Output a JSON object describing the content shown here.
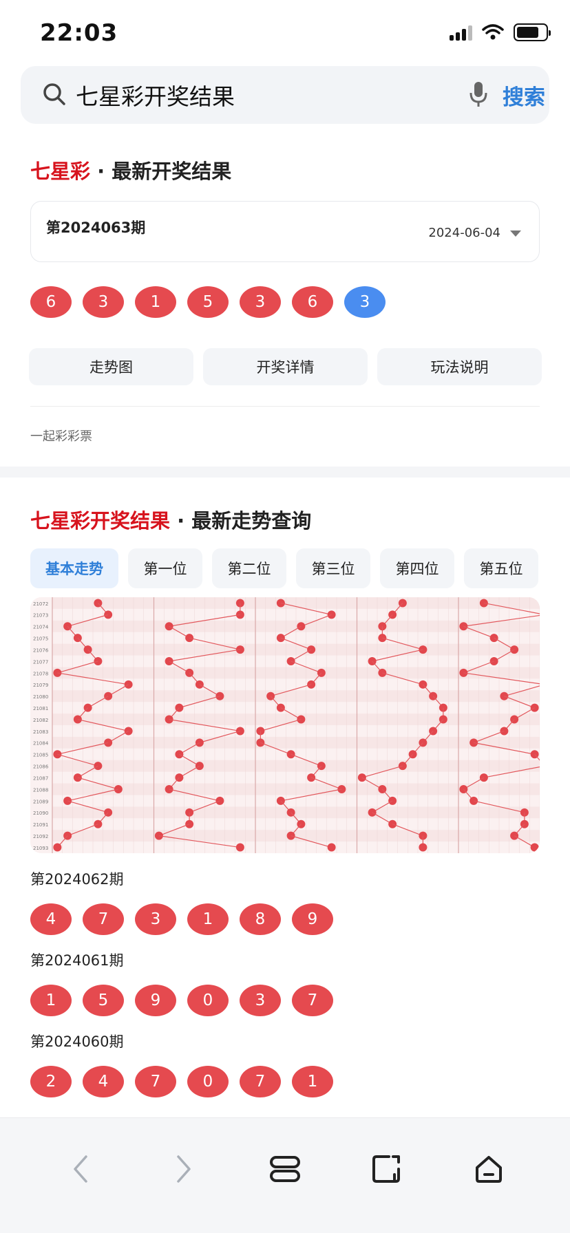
{
  "status_bar": {
    "time": "22:03"
  },
  "search": {
    "query": "七星彩开奖结果",
    "button_label": "搜索"
  },
  "latest": {
    "title_red": "七星彩",
    "title_rest": " · 最新开奖结果",
    "issue": "第2024063期",
    "date": "2024-06-04",
    "numbers": [
      "6",
      "3",
      "1",
      "5",
      "3",
      "6"
    ],
    "special": "3",
    "actions": [
      "走势图",
      "开奖详情",
      "玩法说明"
    ],
    "source": "一起彩彩票"
  },
  "trend": {
    "title_red": "七星彩开奖结果",
    "title_rest": " · 最新走势查询",
    "tabs": [
      "基本走势",
      "第一位",
      "第二位",
      "第三位",
      "第四位",
      "第五位"
    ],
    "active_tab": 0,
    "row_labels": [
      "21072",
      "21073",
      "21074",
      "21075",
      "21076",
      "21077",
      "21078",
      "21079",
      "21080",
      "21081",
      "21082",
      "21083",
      "21084",
      "21085",
      "21086",
      "21087",
      "21088",
      "21089",
      "21090",
      "21091",
      "21092",
      "21093"
    ]
  },
  "history": [
    {
      "issue": "第2024062期",
      "numbers": [
        "4",
        "7",
        "3",
        "1",
        "8",
        "9"
      ]
    },
    {
      "issue": "第2024061期",
      "numbers": [
        "1",
        "5",
        "9",
        "0",
        "3",
        "7"
      ]
    },
    {
      "issue": "第2024060期",
      "numbers": [
        "2",
        "4",
        "7",
        "0",
        "7",
        "1"
      ]
    }
  ],
  "colors": {
    "accent": "#2f7fd8",
    "brand_red": "#d7131d",
    "ball_red": "#e54a4f",
    "ball_blue": "#4a8df0"
  }
}
